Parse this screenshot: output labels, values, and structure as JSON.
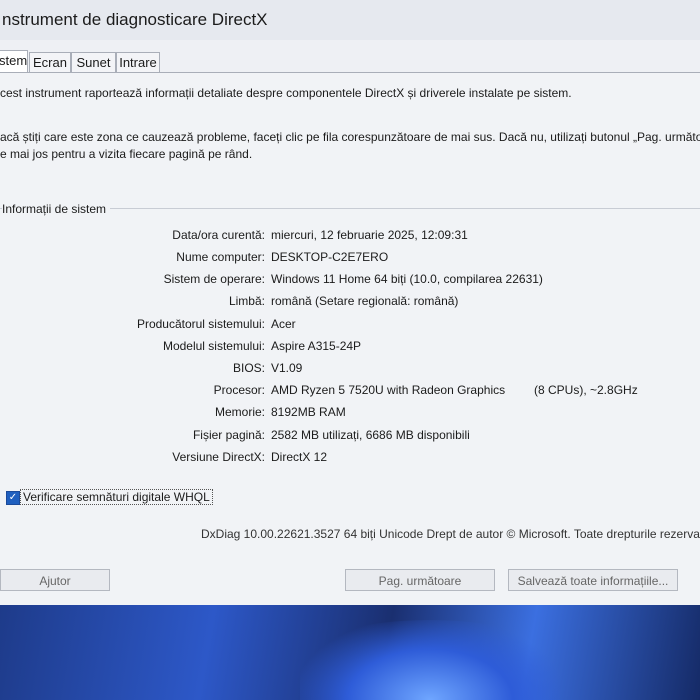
{
  "window": {
    "title": "nstrument de diagnosticare DirectX"
  },
  "tabs": [
    {
      "label": "stem",
      "active": true
    },
    {
      "label": "Ecran",
      "active": false
    },
    {
      "label": "Sunet",
      "active": false
    },
    {
      "label": "Intrare",
      "active": false
    }
  ],
  "intro": {
    "line1": "cest instrument raportează informații detaliate despre componentele DirectX și driverele instalate pe sistem.",
    "line2": "acă știți care este zona ce cauzează probleme, faceți clic pe fila corespunzătoare de mai sus. Dacă nu, utilizați butonul „Pag. următoa",
    "line3": "e mai jos pentru a vizita fiecare pagină pe rând."
  },
  "system_info": {
    "group_title": "Informații de sistem",
    "rows": [
      {
        "label": "Data/ora curentă:",
        "value": "miercuri, 12 februarie 2025, 12:09:31"
      },
      {
        "label": "Nume computer:",
        "value": "DESKTOP-C2E7ERO"
      },
      {
        "label": "Sistem de operare:",
        "value": "Windows 11 Home 64 biți (10.0, compilarea 22631)"
      },
      {
        "label": "Limbă:",
        "value": "română (Setare regională: română)"
      },
      {
        "label": "Producătorul sistemului:",
        "value": "Acer"
      },
      {
        "label": "Modelul sistemului:",
        "value": "Aspire A315-24P"
      },
      {
        "label": "BIOS:",
        "value": "V1.09"
      },
      {
        "label": "Procesor:",
        "value": "AMD Ryzen 5 7520U with Radeon Graphics",
        "extra": "(8 CPUs), ~2.8GHz"
      },
      {
        "label": "Memorie:",
        "value": "8192MB RAM"
      },
      {
        "label": "Fișier pagină:",
        "value": "2582 MB utilizați, 6686 MB disponibili"
      },
      {
        "label": "Versiune DirectX:",
        "value": "DirectX 12"
      }
    ]
  },
  "whql": {
    "label": "Verificare semnături digitale WHQL",
    "checked": true
  },
  "footer_info": "DxDiag 10.00.22621.3527 64 biți Unicode  Drept de autor © Microsoft. Toate drepturile rezerva",
  "buttons": {
    "help": "Ajutor",
    "next": "Pag. următoare",
    "save_all": "Salvează toate informațiile..."
  },
  "colors": {
    "checkbox_accent": "#1f5fbf",
    "desktop_blue": "#2d58c8"
  }
}
